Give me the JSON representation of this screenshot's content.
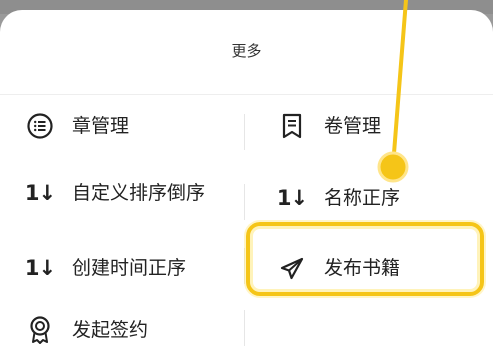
{
  "sheet": {
    "title": "更多"
  },
  "menu": {
    "chapter_manage": {
      "label": "章管理",
      "icon": "list-icon"
    },
    "volume_manage": {
      "label": "卷管理",
      "icon": "bookmark-icon"
    },
    "custom_sort_desc": {
      "label": "自定义排序倒序",
      "icon": "sort-icon",
      "glyph": "1↓"
    },
    "name_sort_asc": {
      "label": "名称正序",
      "icon": "sort-icon",
      "glyph": "1↓"
    },
    "create_time_asc": {
      "label": "创建时间正序",
      "icon": "sort-icon",
      "glyph": "1↓"
    },
    "publish_book": {
      "label": "发布书籍",
      "icon": "send-icon"
    },
    "sign_contract": {
      "label": "发起签约",
      "icon": "award-icon"
    }
  },
  "annotation": {
    "highlight_color": "#f5c518"
  }
}
